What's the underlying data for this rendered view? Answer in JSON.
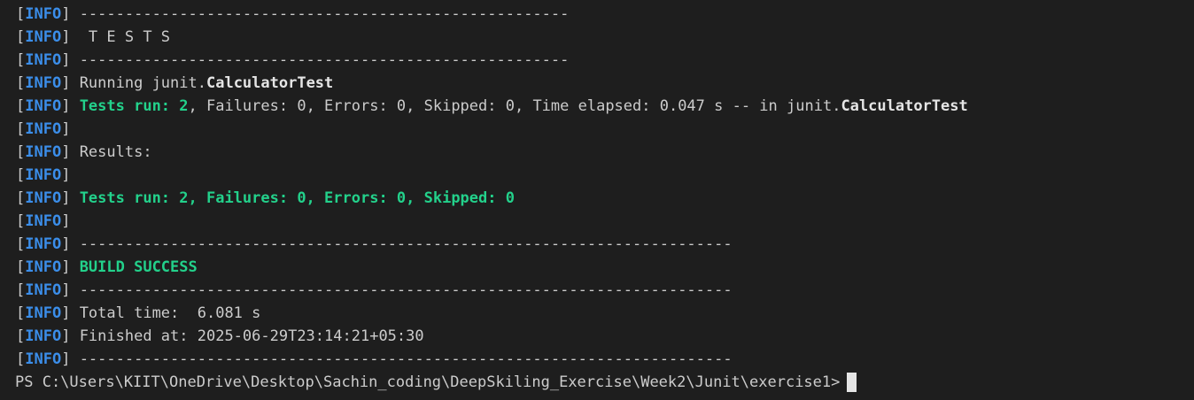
{
  "terminal": {
    "tag": "INFO",
    "lines": [
      {
        "segments": [
          {
            "t": "------------------------------------------------------",
            "s": "plain"
          }
        ]
      },
      {
        "segments": [
          {
            "t": " T E S T S",
            "s": "plain"
          }
        ]
      },
      {
        "segments": [
          {
            "t": "------------------------------------------------------",
            "s": "plain"
          }
        ]
      },
      {
        "segments": [
          {
            "t": "Running junit.",
            "s": "plain"
          },
          {
            "t": "CalculatorTest",
            "s": "bold"
          }
        ]
      },
      {
        "segments": [
          {
            "t": "Tests run: 2",
            "s": "green"
          },
          {
            "t": ", Failures: 0, Errors: 0, Skipped: 0, Time elapsed: 0.047 s -- in junit.",
            "s": "plain"
          },
          {
            "t": "CalculatorTest",
            "s": "bold"
          }
        ]
      },
      {
        "segments": []
      },
      {
        "segments": [
          {
            "t": "Results:",
            "s": "plain"
          }
        ]
      },
      {
        "segments": []
      },
      {
        "segments": [
          {
            "t": "Tests run: 2, Failures: 0, Errors: 0, Skipped: 0",
            "s": "green"
          }
        ]
      },
      {
        "segments": []
      },
      {
        "segments": [
          {
            "t": "------------------------------------------------------------------------",
            "s": "plain"
          }
        ]
      },
      {
        "segments": [
          {
            "t": "BUILD SUCCESS",
            "s": "green"
          }
        ]
      },
      {
        "segments": [
          {
            "t": "------------------------------------------------------------------------",
            "s": "plain"
          }
        ]
      },
      {
        "segments": [
          {
            "t": "Total time:  6.081 s",
            "s": "plain"
          }
        ]
      },
      {
        "segments": [
          {
            "t": "Finished at: 2025-06-29T23:14:21+05:30",
            "s": "plain"
          }
        ]
      },
      {
        "segments": [
          {
            "t": "------------------------------------------------------------------------",
            "s": "plain"
          }
        ]
      }
    ],
    "prompt": "PS C:\\Users\\KIIT\\OneDrive\\Desktop\\Sachin_coding\\DeepSkiling_Exercise\\Week2\\Junit\\exercise1>"
  },
  "colors": {
    "background": "#1e1e1e",
    "info_tag": "#3b8eea",
    "success_green": "#23d18b",
    "text": "#cccccc"
  }
}
